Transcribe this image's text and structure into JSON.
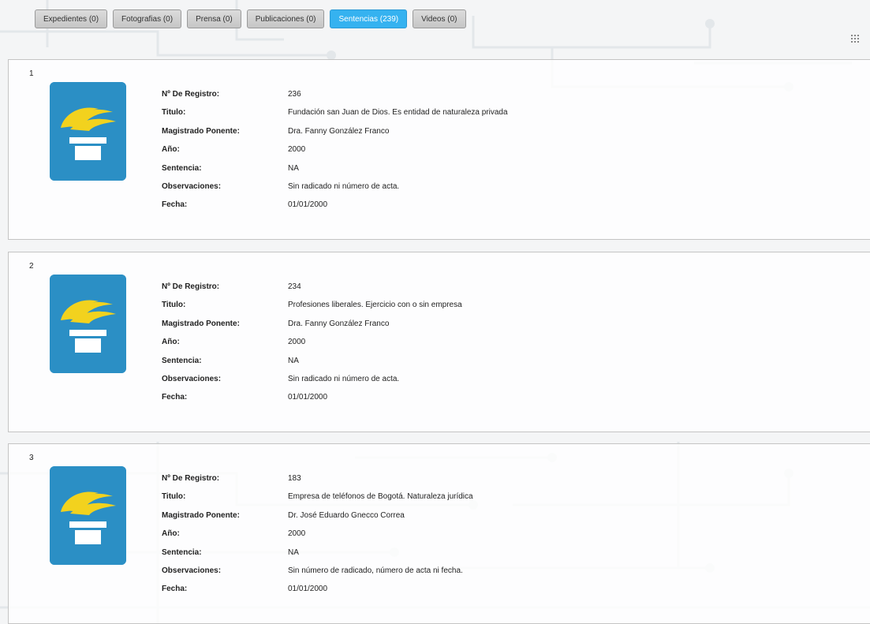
{
  "tabs": [
    {
      "label": "Expedientes (0)",
      "active": false
    },
    {
      "label": "Fotografias (0)",
      "active": false
    },
    {
      "label": "Prensa (0)",
      "active": false
    },
    {
      "label": "Publicaciones (0)",
      "active": false
    },
    {
      "label": "Sentencias (239)",
      "active": true
    },
    {
      "label": "Videos (0)",
      "active": false
    }
  ],
  "view_toggle_icon": "grid-icon",
  "colors": {
    "accent": "#35b2f0",
    "thumb_bg": "#2b8fc5",
    "torch": "#f2d21e"
  },
  "labels": {
    "registro": "Nº De Registro:",
    "titulo": "Titulo:",
    "magistrado": "Magistrado Ponente:",
    "anio": "Año:",
    "sentencia": "Sentencia:",
    "observaciones": "Observaciones:",
    "fecha": "Fecha:"
  },
  "results": [
    {
      "index": "1",
      "registro": "236",
      "titulo": "Fundación san Juan de Dios. Es entidad de naturaleza privada",
      "magistrado": "Dra. Fanny González Franco",
      "anio": "2000",
      "sentencia": "NA",
      "observaciones": "Sin radicado ni número de acta.",
      "fecha": "01/01/2000"
    },
    {
      "index": "2",
      "registro": "234",
      "titulo": "Profesiones liberales. Ejercicio con o sin empresa",
      "magistrado": "Dra. Fanny González Franco",
      "anio": "2000",
      "sentencia": "NA",
      "observaciones": "Sin radicado ni número de acta.",
      "fecha": "01/01/2000"
    },
    {
      "index": "3",
      "registro": "183",
      "titulo": "Empresa de teléfonos de Bogotá. Naturaleza jurídica",
      "magistrado": "Dr. José Eduardo Gnecco Correa",
      "anio": "2000",
      "sentencia": "NA",
      "observaciones": "Sin número de radicado, número de acta ni fecha.",
      "fecha": "01/01/2000"
    }
  ]
}
